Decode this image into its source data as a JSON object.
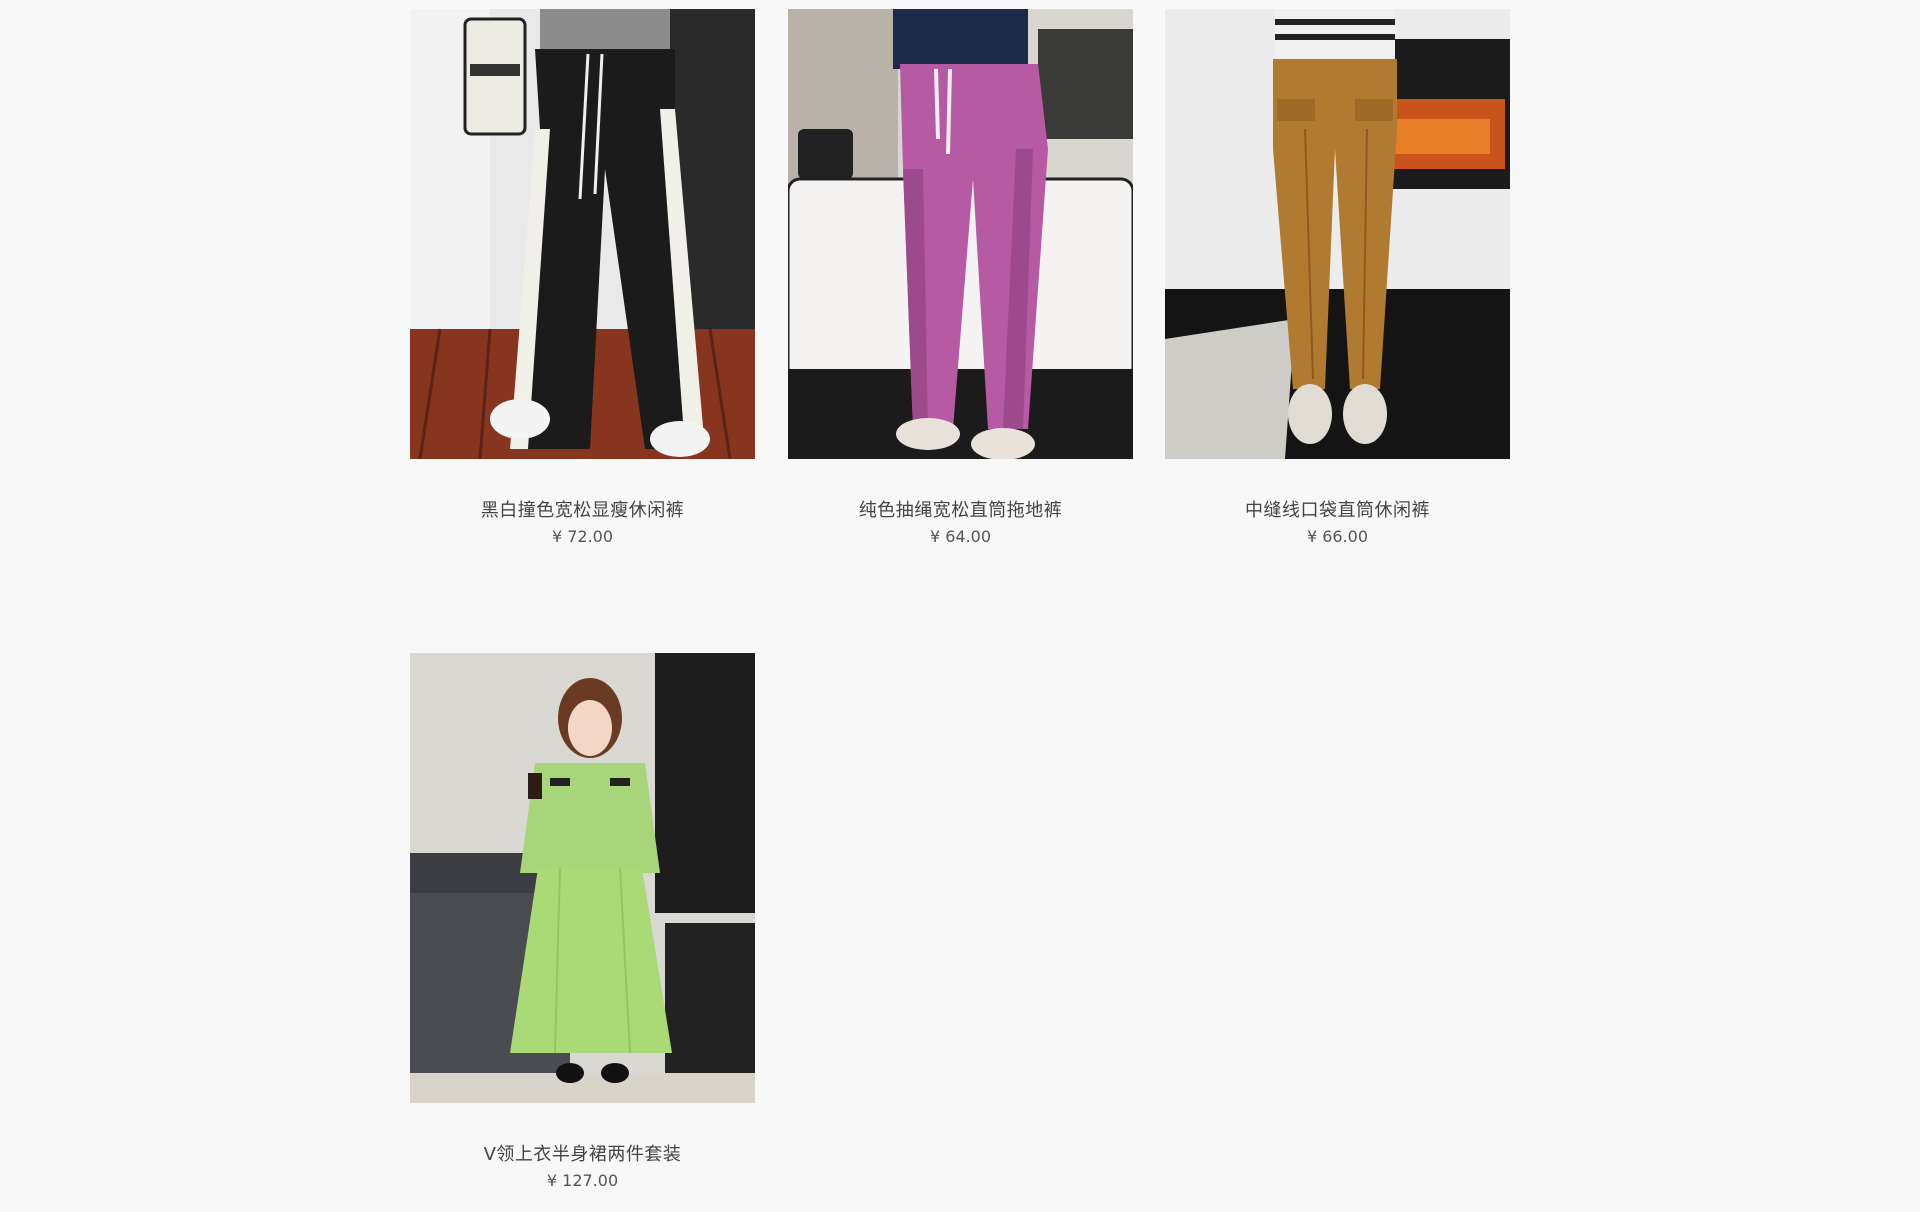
{
  "products": [
    {
      "name": "黑白撞色宽松显瘦休闲裤",
      "price": "¥ 72.00"
    },
    {
      "name": "纯色抽绳宽松直筒拖地裤",
      "price": "¥ 64.00"
    },
    {
      "name": "中缝线口袋直筒休闲裤",
      "price": "¥ 66.00"
    },
    {
      "name": "V领上衣半身裙两件套装",
      "price": "¥ 127.00"
    }
  ]
}
